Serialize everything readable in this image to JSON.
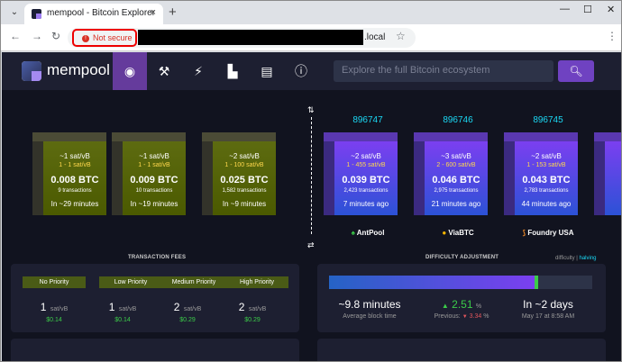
{
  "browser": {
    "tab_title": "mempool - Bitcoin Explorer",
    "tab_close": "×",
    "new_tab": "+",
    "not_secure": "Not secure",
    "url_suffix": ".local"
  },
  "nav": {
    "brand": "mempool",
    "search_placeholder": "Explore the full Bitcoin ecosystem",
    "items": [
      "dashboard-icon",
      "mining-hammer-icon",
      "lightning-icon",
      "graphs-icon",
      "docs-book-icon",
      "about-info-icon"
    ]
  },
  "pending_blocks": [
    {
      "fee": "~1 sat/vB",
      "range": "1 - 1 sat/vB",
      "size": "0.008 BTC",
      "tx": "9 transactions",
      "time": "In ~29 minutes"
    },
    {
      "fee": "~1 sat/vB",
      "range": "1 - 1 sat/vB",
      "size": "0.009 BTC",
      "tx": "10 transactions",
      "time": "In ~19 minutes"
    },
    {
      "fee": "~2 sat/vB",
      "range": "1 - 100 sat/vB",
      "size": "0.025 BTC",
      "tx": "1,582 transactions",
      "time": "In ~9 minutes"
    }
  ],
  "mined_blocks": [
    {
      "height": "896747",
      "fee": "~2 sat/vB",
      "range": "1 - 455 sat/vB",
      "size": "0.039 BTC",
      "tx": "2,423 transactions",
      "time": "7 minutes ago",
      "pool": "AntPool"
    },
    {
      "height": "896746",
      "fee": "~3 sat/vB",
      "range": "2 - 600 sat/vB",
      "size": "0.046 BTC",
      "tx": "2,975 transactions",
      "time": "21 minutes ago",
      "pool": "ViaBTC"
    },
    {
      "height": "896745",
      "fee": "~2 sat/vB",
      "range": "1 - 153 sat/vB",
      "size": "0.043 BTC",
      "tx": "2,783 transactions",
      "time": "44 minutes ago",
      "pool": "Foundry USA"
    }
  ],
  "fees": {
    "title": "TRANSACTION FEES",
    "labels": [
      "No Priority",
      "Low Priority",
      "Medium Priority",
      "High Priority"
    ],
    "values": [
      "1",
      "1",
      "2",
      "2"
    ],
    "unit": "sat/vB",
    "usd": [
      "$0.14",
      "$0.14",
      "$0.29",
      "$0.29"
    ]
  },
  "difficulty": {
    "title": "DIFFICULTY ADJUSTMENT",
    "link_difficulty": "difficulty",
    "sep": "|",
    "link_halving": "halving",
    "progress_fraction": 0.78,
    "avg_time": "~9.8 minutes",
    "avg_label": "Average block time",
    "change": "2.51",
    "change_unit": "%",
    "previous_label": "Previous:",
    "previous": "3.34",
    "previous_unit": "%",
    "eta": "In ~2 days",
    "eta_date": "May 17 at 8:58 AM"
  }
}
